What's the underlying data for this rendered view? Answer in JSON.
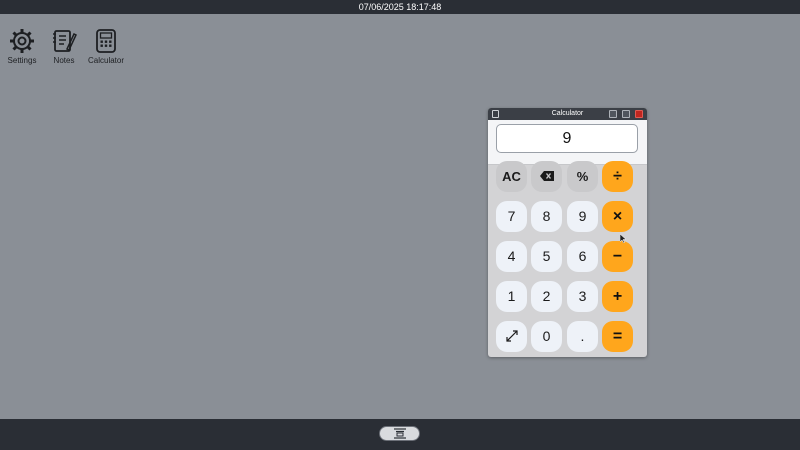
{
  "topbar": {
    "datetime": "07/06/2025 18:17:48"
  },
  "desktop": {
    "icons": [
      {
        "label": "Settings",
        "icon": "gear-icon"
      },
      {
        "label": "Notes",
        "icon": "notes-icon"
      },
      {
        "label": "Calculator",
        "icon": "calculator-icon"
      }
    ]
  },
  "window": {
    "title": "Calculator",
    "display_value": "9",
    "keys": {
      "ac": "AC",
      "backspace": "⌫",
      "percent": "%",
      "divide": "÷",
      "seven": "7",
      "eight": "8",
      "nine": "9",
      "multiply": "×",
      "four": "4",
      "five": "5",
      "six": "6",
      "minus": "−",
      "one": "1",
      "two": "2",
      "three": "3",
      "plus": "+",
      "expand": "⤢",
      "zero": "0",
      "dot": ".",
      "equals": "="
    }
  },
  "colors": {
    "desktop_bg": "#8a8f96",
    "bar_bg": "#2a2e35",
    "operator_key": "#ffa61c",
    "function_key": "#c9c9cb",
    "digit_key": "#eef2f8",
    "close_button": "#c0261f"
  }
}
